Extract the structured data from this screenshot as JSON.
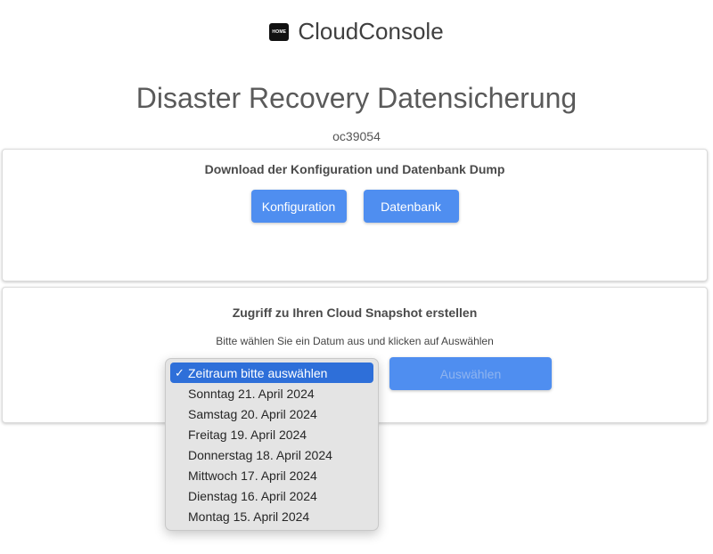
{
  "brand": {
    "logo_text": "HOME",
    "name": "CloudConsole"
  },
  "page": {
    "title": "Disaster Recovery Datensicherung",
    "id": "oc39054"
  },
  "download_card": {
    "title": "Download der Konfiguration und Datenbank Dump",
    "config_button": "Konfiguration",
    "db_button": "Datenbank"
  },
  "snapshot_card": {
    "title": "Zugriff zu Ihren Cloud Snapshot erstellen",
    "hint": "Bitte wählen Sie ein Datum aus und klicken auf Auswählen",
    "select_button": "Auswählen"
  },
  "date_select": {
    "check_glyph": "✓",
    "options": [
      "Zeitraum bitte auswählen",
      "Sonntag 21. April 2024",
      "Samstag 20. April 2024",
      "Freitag 19. April 2024",
      "Donnerstag 18. April 2024",
      "Mittwoch 17. April 2024",
      "Dienstag 16. April 2024",
      "Montag 15. April 2024"
    ]
  },
  "colors": {
    "accent": "#4f8ef0",
    "selected_option": "#2e6fd9"
  }
}
